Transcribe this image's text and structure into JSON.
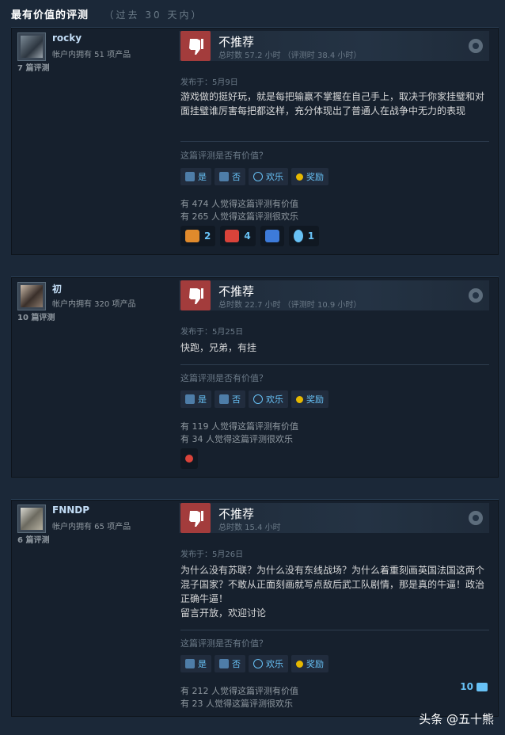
{
  "header": {
    "title": "最有价值的评测",
    "subtitle": "（过去 30 天内）"
  },
  "labels": {
    "helpful_question": "这篇评测是否有价值？",
    "yes": "是",
    "no": "否",
    "funny": "欢乐",
    "award": "奖励"
  },
  "reviews": [
    {
      "author": "rocky",
      "owned": "帐户内拥有 51 项产品",
      "review_count": "7 篇评测",
      "verdict": "不推荐",
      "hours": "总时数 57.2 小时 （评测时 38.4 小时）",
      "posted": "发布于：5月9日",
      "content": "游戏做的挺好玩，就是每把输赢不掌握在自己手上，取决于你家挂璧和对面挂璧谁厉害每把都这样，充分体现出了普通人在战争中无力的表现",
      "helpful": "有 474 人觉得这篇评测有价值",
      "funny": "有 265 人觉得这篇评测很欢乐",
      "awards": [
        {
          "icon": "hand-icon",
          "count": "2",
          "color": "#e08a2c"
        },
        {
          "icon": "face-icon",
          "count": "4",
          "color": "#d9433a"
        },
        {
          "icon": "gift-icon",
          "count": "",
          "color": "#3d7bd9"
        },
        {
          "icon": "ribbon-icon",
          "count": "1",
          "color": "#67c1f5"
        }
      ]
    },
    {
      "author": "初",
      "owned": "帐户内拥有 320 项产品",
      "review_count": "10 篇评测",
      "verdict": "不推荐",
      "hours": "总时数 22.7 小时 （评测时 10.9 小时）",
      "posted": "发布于：5月25日",
      "content": "快跑，兄弟，有挂",
      "helpful": "有 119 人觉得这篇评测有价值",
      "funny": "有 34 人觉得这篇评测很欢乐",
      "awards": [
        {
          "icon": "mushroom-icon",
          "count": "",
          "color": "#d9433a"
        }
      ]
    },
    {
      "author": "FNNDP",
      "owned": "帐户内拥有 65 项产品",
      "review_count": "6 篇评测",
      "verdict": "不推荐",
      "hours": "总时数 15.4 小时",
      "posted": "发布于：5月26日",
      "content_lines": [
        "为什么没有苏联？为什么没有东线战场？为什么着重刻画英国法国这两个混子国家？不敢从正面刻画就写点敌后武工队剧情，那是真的牛逼！政治正确牛逼！",
        "留言开放，欢迎讨论"
      ],
      "helpful": "有 212 人觉得这篇评测有价值",
      "funny": "有 23 人觉得这篇评测很欢乐",
      "comments": "10"
    }
  ],
  "watermark": "头条 @五十熊"
}
